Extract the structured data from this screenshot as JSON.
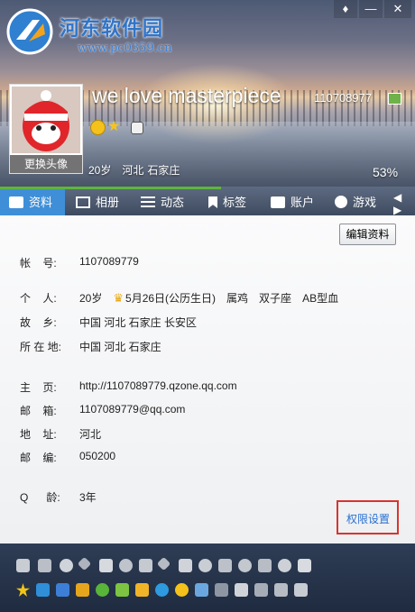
{
  "window": {
    "skin_glyph": "♦",
    "min_glyph": "—",
    "close_glyph": "✕"
  },
  "logo": {
    "text": "河东软件园",
    "url": "www.pc0359.cn"
  },
  "profile": {
    "nickname": "we love masterpiece",
    "qq_number": "110708977",
    "change_avatar": "更换头像",
    "age": "20岁",
    "province": "河北",
    "city": "石家庄",
    "completion": "53%"
  },
  "tabs": [
    {
      "label": "资料",
      "icon": "profile-card-icon"
    },
    {
      "label": "相册",
      "icon": "album-icon"
    },
    {
      "label": "动态",
      "icon": "feed-icon"
    },
    {
      "label": "标签",
      "icon": "tag-icon"
    },
    {
      "label": "账户",
      "icon": "wallet-icon"
    },
    {
      "label": "游戏",
      "icon": "game-icon"
    }
  ],
  "tabs_arrows": "◀ ▶",
  "edit_button": "编辑资料",
  "details": {
    "account": {
      "label": "帐    号:",
      "value": "1107089779"
    },
    "personal": {
      "label": "个    人:",
      "age": "20岁",
      "birthday": "5月26日(公历生日)",
      "zodiac": "属鸡",
      "constellation": "双子座",
      "blood": "AB型血"
    },
    "hometown": {
      "label": "故    乡:",
      "value": "中国 河北 石家庄 长安区"
    },
    "location": {
      "label": "所 在 地:",
      "value": "中国 河北 石家庄"
    },
    "homepage": {
      "label": "主    页:",
      "value": "http://1107089779.qzone.qq.com"
    },
    "email": {
      "label": "邮    箱:",
      "value": "1107089779@qq.com"
    },
    "address": {
      "label": "地    址:",
      "value": "河北"
    },
    "zip": {
      "label": "邮    编:",
      "value": "050200"
    },
    "qage": {
      "label": "Q      龄:",
      "value": "3年"
    }
  },
  "privacy_link": "权限设置",
  "colors": {
    "accent_blue": "#3f8fd8",
    "tab_bar": "#4a576d",
    "highlight_red": "#d9342e",
    "link_blue": "#2a6fd0",
    "progress_green": "#5fb53c"
  }
}
